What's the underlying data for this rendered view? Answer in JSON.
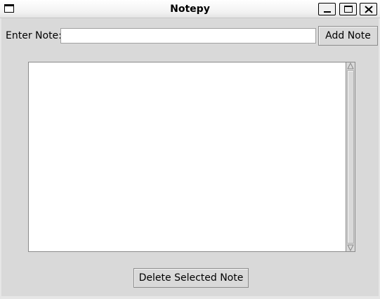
{
  "window": {
    "title": "Notepy",
    "icons": {
      "app": "window-icon",
      "minimize": "minimize-icon",
      "maximize": "maximize-icon",
      "close": "close-icon"
    }
  },
  "form": {
    "label": "Enter Note:",
    "input_value": "",
    "add_button": "Add Note"
  },
  "notes": {
    "items": []
  },
  "actions": {
    "delete_button": "Delete Selected Note"
  },
  "colors": {
    "background": "#d9d9d9",
    "list_background": "#ffffff",
    "border": "#8a8a8a"
  }
}
